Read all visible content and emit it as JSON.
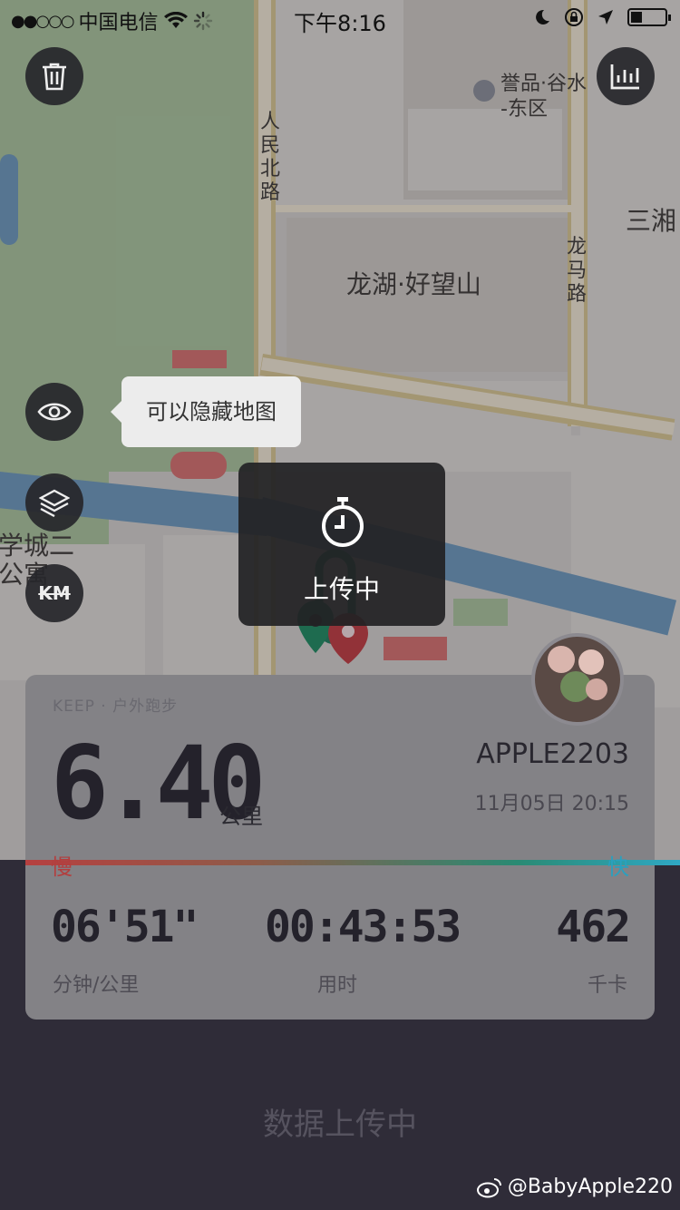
{
  "status_bar": {
    "carrier": "中国电信",
    "time": "下午8:16",
    "signal_icon": "signal-dots-icon",
    "wifi_icon": "wifi-icon",
    "loading_icon": "activity-spinner-icon",
    "moon_icon": "do-not-disturb-icon",
    "lock_icon": "orientation-lock-icon",
    "location_icon": "location-arrow-icon",
    "battery_icon": "battery-icon"
  },
  "map": {
    "labels": {
      "poi1_line1": "誉品·谷水",
      "poi1_line2": "-东区",
      "road_renmin": "人民北路",
      "estate": "龙湖·好望山",
      "road_longma": "龙马路",
      "sanxiang": "三湘",
      "xuecheng_1": "学城二",
      "xuecheng_2": "公寓"
    },
    "tooltip": "可以隐藏地图",
    "controls": {
      "delete_icon": "trash-icon",
      "stats_icon": "bar-chart-icon",
      "visibility_icon": "eye-icon",
      "layers_icon": "layers-icon",
      "km_label": "KM"
    }
  },
  "toast": {
    "icon": "stopwatch-icon",
    "text": "上传中"
  },
  "card": {
    "source": "KEEP · 户外跑步",
    "distance": "6.40",
    "distance_unit": "公里",
    "username": "APPLE2203",
    "datetime": "11月05日 20:15",
    "pace_slow": "慢",
    "pace_fast": "快",
    "stats": {
      "pace_value": "06'51\"",
      "pace_label": "分钟/公里",
      "duration_value": "00:43:53",
      "duration_label": "用时",
      "calories_value": "462",
      "calories_label": "千卡"
    }
  },
  "bottom": {
    "status_text": "数据上传中",
    "watermark": "@BabyApple220"
  },
  "colors": {
    "background": "#2f2c38",
    "pace_slow": "#b33e3e",
    "pace_fast": "#2aa0bf"
  }
}
